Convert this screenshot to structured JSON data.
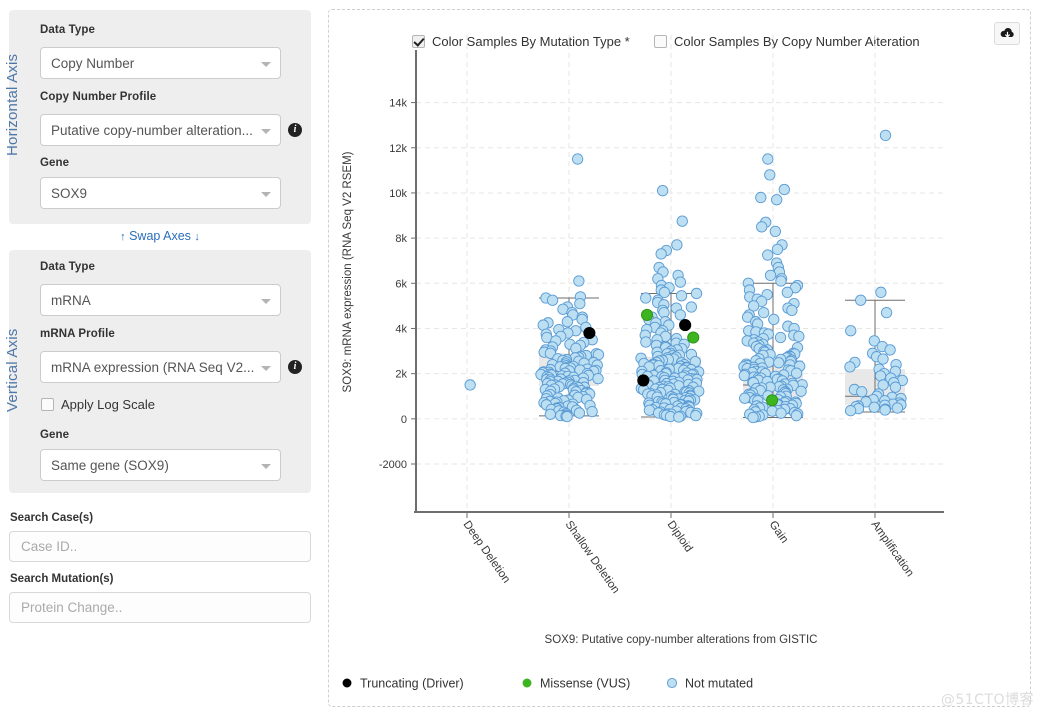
{
  "sidebar": {
    "horizontal_axis": {
      "group_label": "Horizontal Axis",
      "data_type_label": "Data Type",
      "data_type_value": "Copy Number",
      "profile_label": "Copy Number Profile",
      "profile_value": "Putative copy-number alteration...",
      "profile_info_icon": "info-icon",
      "gene_label": "Gene",
      "gene_value": "SOX9"
    },
    "swap_axes": {
      "label": "Swap Axes",
      "up_arrow": "↑",
      "down_arrow": "↓"
    },
    "vertical_axis": {
      "group_label": "Vertical Axis",
      "data_type_label": "Data Type",
      "data_type_value": "mRNA",
      "profile_label": "mRNA Profile",
      "profile_value": "mRNA expression (RNA Seq V2...",
      "profile_info_icon": "info-icon",
      "log_scale_label": "Apply Log Scale",
      "log_scale_checked": false,
      "gene_label": "Gene",
      "gene_value": "Same gene (SOX9)"
    },
    "search_cases": {
      "label": "Search Case(s)",
      "value": "",
      "placeholder": "Case ID.."
    },
    "search_mutations": {
      "label": "Search Mutation(s)",
      "value": "",
      "placeholder": "Protein Change.."
    }
  },
  "toolbar": {
    "color_by_mutation": {
      "label": "Color Samples By Mutation Type *",
      "checked": true
    },
    "color_by_cna": {
      "label": "Color Samples By Copy Number Alteration",
      "checked": false
    },
    "download_button": {
      "icon": "cloud-download-icon",
      "title": "Download"
    }
  },
  "watermark": "@51CTO博客",
  "colors": {
    "accent_blue": "#2a6ebb",
    "axis_label_blue": "#4f78a8",
    "point_not_mutated_fill": "#bcdff1",
    "point_not_mutated_stroke": "#5b9bd5",
    "point_truncating": "#000000",
    "point_missense": "#3cb521",
    "box_fill": "#e8e8e8",
    "box_line": "#6e6e6e",
    "gridline": "#e6e6e6",
    "panel_bg": "#eeeeee"
  },
  "chart_data": {
    "type": "scatter",
    "plot_style": "box-with-jittered-points",
    "title": "",
    "xlabel": "SOX9: Putative copy-number alterations from GISTIC",
    "ylabel": "SOX9: mRNA expression (RNA Seq V2 RSEM)",
    "categories": [
      "Deep Deletion",
      "Shallow Deletion",
      "Diploid",
      "Gain",
      "Amplification"
    ],
    "ylim": [
      -2000,
      15000
    ],
    "yticks": [
      -2000,
      0,
      2000,
      4000,
      6000,
      8000,
      10000,
      12000,
      14000
    ],
    "ytick_labels": [
      "-2000",
      "0",
      "2k",
      "4k",
      "6k",
      "8k",
      "10k",
      "12k",
      "14k"
    ],
    "grid": true,
    "legend_position": "bottom-left",
    "legend": [
      {
        "label": "Truncating (Driver)",
        "color": "#000000"
      },
      {
        "label": "Missense (VUS)",
        "color": "#3cb521"
      },
      {
        "label": "Not mutated",
        "color": "#bcdff1"
      }
    ],
    "boxes": [
      {
        "category": "Deep Deletion",
        "n": 1,
        "q1": null,
        "median": null,
        "q3": null,
        "whisker_low": null,
        "whisker_high": null
      },
      {
        "category": "Shallow Deletion",
        "n": 148,
        "q1": 1450,
        "median": 2100,
        "q3": 2900,
        "whisker_low": 130,
        "whisker_high": 5350
      },
      {
        "category": "Diploid",
        "n": 196,
        "q1": 1200,
        "median": 1800,
        "q3": 2750,
        "whisker_low": 80,
        "whisker_high": 5550
      },
      {
        "category": "Gain",
        "n": 212,
        "q1": 900,
        "median": 1500,
        "q3": 2600,
        "whisker_low": 60,
        "whisker_high": 6000
      },
      {
        "category": "Amplification",
        "n": 44,
        "q1": 620,
        "median": 1000,
        "q3": 2200,
        "whisker_low": 300,
        "whisker_high": 5250
      }
    ],
    "series": [
      {
        "name": "Not mutated",
        "color": "#bcdff1",
        "points_by_category": {
          "Deep Deletion": [
            1500
          ],
          "Shallow Deletion": [
            11500,
            6100,
            5400,
            5350,
            5250,
            5100,
            4950,
            4850,
            4700,
            4600,
            4500,
            4400,
            4300,
            4250,
            4150,
            4050,
            3950,
            3900,
            3800,
            3750,
            3650,
            3600,
            3500,
            3450,
            3380,
            3300,
            3250,
            3180,
            3120,
            3050,
            3000,
            2950,
            2900,
            2880,
            2840,
            2800,
            2760,
            2720,
            2700,
            2660,
            2620,
            2580,
            2550,
            2520,
            2490,
            2460,
            2430,
            2400,
            2380,
            2350,
            2320,
            2300,
            2280,
            2250,
            2230,
            2200,
            2180,
            2160,
            2140,
            2120,
            2100,
            2080,
            2060,
            2040,
            2020,
            2000,
            1980,
            1960,
            1940,
            1920,
            1900,
            1880,
            1860,
            1840,
            1820,
            1800,
            1780,
            1760,
            1740,
            1720,
            1700,
            1680,
            1660,
            1640,
            1620,
            1600,
            1580,
            1560,
            1540,
            1520,
            1500,
            1480,
            1460,
            1440,
            1420,
            1400,
            1380,
            1350,
            1320,
            1300,
            1280,
            1250,
            1220,
            1200,
            1180,
            1150,
            1120,
            1100,
            1070,
            1040,
            1010,
            980,
            950,
            920,
            890,
            860,
            830,
            800,
            770,
            740,
            710,
            680,
            650,
            620,
            590,
            560,
            530,
            500,
            470,
            440,
            410,
            380,
            350,
            320,
            290,
            260,
            230,
            200,
            170,
            140,
            120,
            100
          ],
          "Diploid": [
            10100,
            8750,
            7700,
            7450,
            7300,
            6700,
            6500,
            6350,
            6200,
            6050,
            5900,
            5800,
            5700,
            5600,
            5550,
            5450,
            5350,
            5250,
            5150,
            5050,
            4950,
            4900,
            4800,
            4700,
            4600,
            4500,
            4400,
            4300,
            4250,
            4150,
            4050,
            3950,
            3900,
            3800,
            3700,
            3650,
            3550,
            3500,
            3400,
            3350,
            3300,
            3250,
            3200,
            3150,
            3100,
            3050,
            3000,
            2950,
            2900,
            2880,
            2850,
            2820,
            2790,
            2760,
            2730,
            2700,
            2680,
            2650,
            2620,
            2590,
            2560,
            2530,
            2500,
            2480,
            2450,
            2420,
            2400,
            2380,
            2350,
            2330,
            2300,
            2280,
            2250,
            2230,
            2200,
            2180,
            2150,
            2130,
            2100,
            2080,
            2050,
            2030,
            2000,
            1980,
            1960,
            1940,
            1920,
            1900,
            1880,
            1860,
            1840,
            1820,
            1800,
            1780,
            1760,
            1740,
            1720,
            1700,
            1680,
            1660,
            1640,
            1620,
            1600,
            1580,
            1560,
            1540,
            1520,
            1500,
            1480,
            1460,
            1440,
            1420,
            1400,
            1380,
            1360,
            1340,
            1320,
            1300,
            1280,
            1260,
            1240,
            1220,
            1200,
            1180,
            1160,
            1140,
            1120,
            1100,
            1080,
            1060,
            1040,
            1020,
            1000,
            980,
            960,
            940,
            920,
            900,
            880,
            860,
            840,
            820,
            800,
            780,
            760,
            740,
            720,
            700,
            680,
            660,
            640,
            620,
            600,
            580,
            560,
            540,
            520,
            500,
            480,
            460,
            440,
            420,
            400,
            380,
            360,
            340,
            320,
            300,
            280,
            260,
            240,
            220,
            200,
            180,
            160,
            140,
            120,
            100,
            80
          ],
          "Gain": [
            11500,
            10800,
            10150,
            9800,
            9700,
            8700,
            8500,
            8300,
            7700,
            7500,
            7250,
            6900,
            6700,
            6500,
            6350,
            6200,
            6100,
            6000,
            5900,
            5800,
            5700,
            5600,
            5500,
            5400,
            5300,
            5200,
            5100,
            5000,
            4900,
            4800,
            4700,
            4600,
            4500,
            4400,
            4300,
            4200,
            4100,
            4000,
            3900,
            3850,
            3800,
            3750,
            3700,
            3650,
            3600,
            3550,
            3500,
            3450,
            3400,
            3350,
            3300,
            3250,
            3200,
            3150,
            3100,
            3050,
            3000,
            2950,
            2900,
            2870,
            2840,
            2810,
            2780,
            2750,
            2720,
            2690,
            2660,
            2630,
            2600,
            2570,
            2540,
            2510,
            2480,
            2450,
            2420,
            2390,
            2360,
            2330,
            2300,
            2280,
            2250,
            2220,
            2190,
            2160,
            2130,
            2100,
            2080,
            2050,
            2020,
            2000,
            1970,
            1940,
            1910,
            1880,
            1850,
            1820,
            1800,
            1770,
            1740,
            1710,
            1680,
            1650,
            1620,
            1600,
            1570,
            1540,
            1510,
            1480,
            1450,
            1420,
            1400,
            1370,
            1340,
            1310,
            1280,
            1250,
            1220,
            1200,
            1170,
            1140,
            1110,
            1080,
            1050,
            1020,
            1000,
            970,
            940,
            910,
            880,
            850,
            820,
            800,
            770,
            740,
            710,
            680,
            650,
            620,
            600,
            570,
            540,
            510,
            480,
            450,
            420,
            400,
            370,
            340,
            310,
            280,
            250,
            220,
            200,
            170,
            140,
            110,
            80,
            60
          ],
          "Amplification": [
            12550,
            5600,
            5250,
            4700,
            3900,
            3450,
            3200,
            3050,
            2900,
            2750,
            2650,
            2500,
            2400,
            2300,
            2200,
            2100,
            2000,
            1900,
            1800,
            1700,
            1600,
            1500,
            1400,
            1300,
            1200,
            1100,
            1000,
            950,
            900,
            850,
            800,
            750,
            700,
            650,
            620,
            600,
            570,
            540,
            510,
            480,
            450,
            420,
            390,
            360
          ]
        }
      },
      {
        "name": "Truncating (Driver)",
        "color": "#000000",
        "points_by_category": {
          "Shallow Deletion": [
            3800
          ],
          "Diploid": [
            4150,
            1700
          ]
        }
      },
      {
        "name": "Missense (VUS)",
        "color": "#3cb521",
        "points_by_category": {
          "Diploid": [
            4600,
            3600
          ],
          "Gain": [
            820
          ]
        }
      }
    ]
  }
}
